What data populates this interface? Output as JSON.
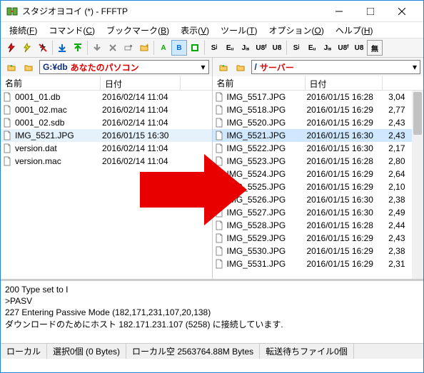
{
  "window": {
    "title": "スタジオヨコイ (*) - FFFTP"
  },
  "menu": {
    "connect": "接続",
    "connect_k": "F",
    "command": "コマンド",
    "command_k": "C",
    "bookmark": "ブックマーク",
    "bookmark_k": "B",
    "view": "表示",
    "view_k": "V",
    "tool": "ツール",
    "tool_k": "T",
    "option": "オプション",
    "option_k": "O",
    "help": "ヘルプ",
    "help_k": "H"
  },
  "toolbar": {
    "s1": "Sʲ",
    "t1": "Eᵤ",
    "j1": "Jᵢₛ",
    "u1": "U8ᶠ",
    "u2": "U8",
    "s2": "Sʲ",
    "t2": "Eᵤ",
    "j2": "Jᵢₛ",
    "u3": "U8ᶠ",
    "u4": "U8",
    "none": "無"
  },
  "local": {
    "path": "G:¥db",
    "label": "あなたのパソコン",
    "cols": {
      "name": "名前",
      "date": "日付"
    },
    "files": [
      {
        "name": "0001_01.db",
        "date": "2016/02/14 11:04"
      },
      {
        "name": "0001_02.mac",
        "date": "2016/02/14 11:04"
      },
      {
        "name": "0001_02.sdb",
        "date": "2016/02/14 11:04"
      },
      {
        "name": "IMG_5521.JPG",
        "date": "2016/01/15 16:30",
        "sel": true
      },
      {
        "name": "version.dat",
        "date": "2016/02/14 11:04"
      },
      {
        "name": "version.mac",
        "date": "2016/02/14 11:04"
      }
    ]
  },
  "remote": {
    "path": "/",
    "label": "サーバー",
    "cols": {
      "name": "名前",
      "date": "日付"
    },
    "files": [
      {
        "name": "IMG_5517.JPG",
        "date": "2016/01/15 16:28",
        "size": "3,04"
      },
      {
        "name": "IMG_5518.JPG",
        "date": "2016/01/15 16:29",
        "size": "2,77"
      },
      {
        "name": "IMG_5520.JPG",
        "date": "2016/01/15 16:29",
        "size": "2,43"
      },
      {
        "name": "IMG_5521.JPG",
        "date": "2016/01/15 16:30",
        "size": "2,43",
        "hl": true
      },
      {
        "name": "IMG_5522.JPG",
        "date": "2016/01/15 16:30",
        "size": "2,17"
      },
      {
        "name": "IMG_5523.JPG",
        "date": "2016/01/15 16:28",
        "size": "2,80"
      },
      {
        "name": "IMG_5524.JPG",
        "date": "2016/01/15 16:29",
        "size": "2,64"
      },
      {
        "name": "IMG_5525.JPG",
        "date": "2016/01/15 16:29",
        "size": "2,10"
      },
      {
        "name": "IMG_5526.JPG",
        "date": "2016/01/15 16:30",
        "size": "2,38"
      },
      {
        "name": "IMG_5527.JPG",
        "date": "2016/01/15 16:30",
        "size": "2,49"
      },
      {
        "name": "IMG_5528.JPG",
        "date": "2016/01/15 16:28",
        "size": "2,44"
      },
      {
        "name": "IMG_5529.JPG",
        "date": "2016/01/15 16:29",
        "size": "2,43"
      },
      {
        "name": "IMG_5530.JPG",
        "date": "2016/01/15 16:29",
        "size": "2,38"
      },
      {
        "name": "IMG_5531.JPG",
        "date": "2016/01/15 16:29",
        "size": "2,31"
      }
    ]
  },
  "log": {
    "l1": "200 Type set to I",
    "l2": ">PASV",
    "l3": "227 Entering Passive Mode (182,171,231,107,20,138)",
    "l4": "ダウンロードのためにホスト 182.171.231.107 (5258) に接続しています."
  },
  "status": {
    "s1": "ローカル",
    "s2": "選択0個 (0 Bytes)",
    "s3": "ローカル空 2563764.88M Bytes",
    "s4": "転送待ちファイル0個"
  }
}
